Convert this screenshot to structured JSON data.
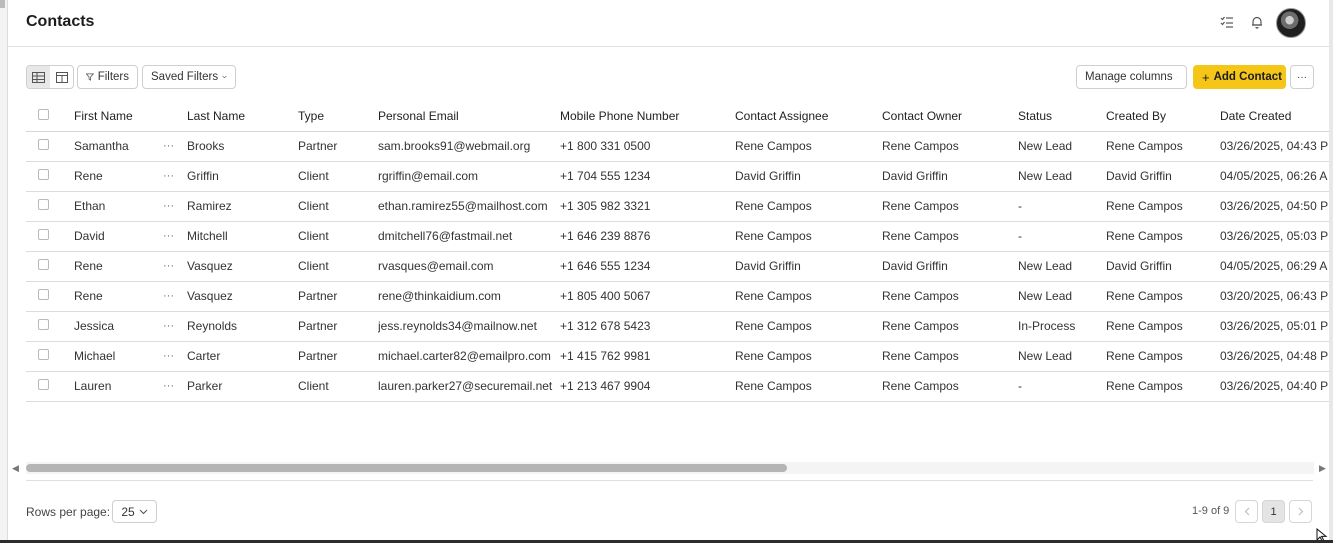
{
  "header": {
    "title": "Contacts"
  },
  "toolbar": {
    "filters_label": "Filters",
    "saved_filters_label": "Saved Filters",
    "manage_columns_label": "Manage columns",
    "add_contact_label": "Add Contact",
    "more_label": "···"
  },
  "table": {
    "columns": [
      "First Name",
      "Last Name",
      "Type",
      "Personal Email",
      "Mobile Phone Number",
      "Contact Assignee",
      "Contact Owner",
      "Status",
      "Created By",
      "Date Created"
    ],
    "row_menu": "···",
    "rows": [
      [
        "Samantha",
        "Brooks",
        "Partner",
        "sam.brooks91@webmail.org",
        "+1 800 331 0500",
        "Rene Campos",
        "Rene Campos",
        "New Lead",
        "Rene Campos",
        "03/26/2025, 04:43 P"
      ],
      [
        "Rene",
        "Griffin",
        "Client",
        "rgriffin@email.com",
        "+1 704 555 1234",
        "David Griffin",
        "David Griffin",
        "New Lead",
        "David Griffin",
        "04/05/2025, 06:26 A"
      ],
      [
        "Ethan",
        "Ramirez",
        "Client",
        "ethan.ramirez55@mailhost.com",
        "+1 305 982 3321",
        "Rene Campos",
        "Rene Campos",
        "-",
        "Rene Campos",
        "03/26/2025, 04:50 P"
      ],
      [
        "David",
        "Mitchell",
        "Client",
        "dmitchell76@fastmail.net",
        "+1 646 239 8876",
        "Rene Campos",
        "Rene Campos",
        "-",
        "Rene Campos",
        "03/26/2025, 05:03 P"
      ],
      [
        "Rene",
        "Vasquez",
        "Client",
        "rvasques@email.com",
        "+1 646 555 1234",
        "David Griffin",
        "David Griffin",
        "New Lead",
        "David Griffin",
        "04/05/2025, 06:29 A"
      ],
      [
        "Rene",
        "Vasquez",
        "Partner",
        "rene@thinkaidium.com",
        "+1 805 400 5067",
        "Rene Campos",
        "Rene Campos",
        "New Lead",
        "Rene Campos",
        "03/20/2025, 06:43 P"
      ],
      [
        "Jessica",
        "Reynolds",
        "Partner",
        "jess.reynolds34@mailnow.net",
        "+1 312 678 5423",
        "Rene Campos",
        "Rene Campos",
        "In-Process",
        "Rene Campos",
        "03/26/2025, 05:01 P"
      ],
      [
        "Michael",
        "Carter",
        "Partner",
        "michael.carter82@emailpro.com",
        "+1 415 762 9981",
        "Rene Campos",
        "Rene Campos",
        "New Lead",
        "Rene Campos",
        "03/26/2025, 04:48 P"
      ],
      [
        "Lauren",
        "Parker",
        "Client",
        "lauren.parker27@securemail.net",
        "+1 213 467 9904",
        "Rene Campos",
        "Rene Campos",
        "-",
        "Rene Campos",
        "03/26/2025, 04:40 P"
      ]
    ]
  },
  "footer": {
    "rows_per_page_label": "Rows per page:",
    "rows_per_page_value": "25",
    "range_text": "1-9 of 9",
    "current_page": "1"
  }
}
